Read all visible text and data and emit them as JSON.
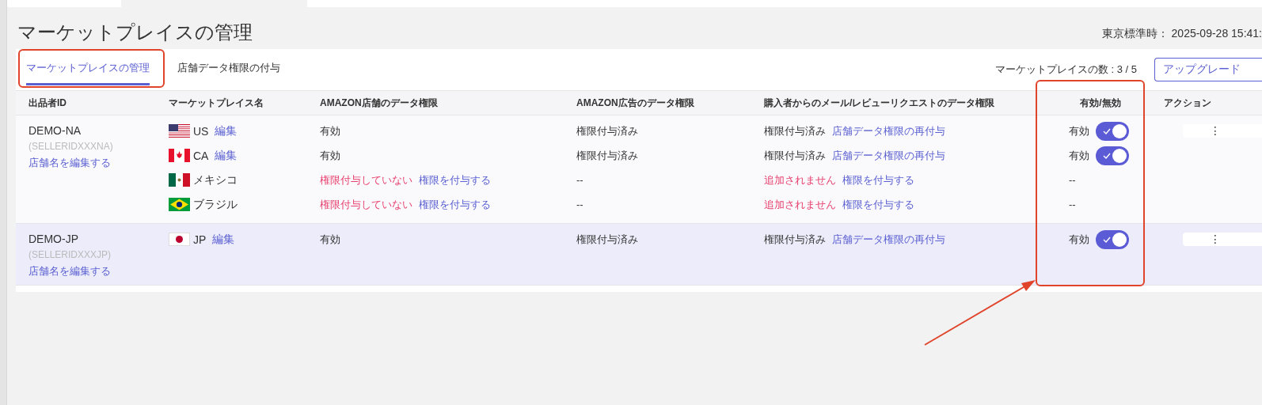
{
  "page_title": "マーケットプレイスの管理",
  "clock": "東京標準時： 2025-09-28 15:41:",
  "tabs": [
    {
      "label": "マーケットプレイスの管理",
      "selected": true
    },
    {
      "label": "店舗データ権限の付与",
      "selected": false
    }
  ],
  "marketplace_count": "マーケットプレイスの数 : 3 / 5",
  "upgrade_button": "アップグレード",
  "table": {
    "columns": [
      "出品者ID",
      "マーケットプレイス名",
      "AMAZON店舗のデータ権限",
      "AMAZON広告のデータ権限",
      "購入者からのメール/レビューリクエストのデータ権限",
      "有効/無効",
      "アクション"
    ],
    "groups": [
      {
        "seller": "DEMO-NA",
        "seller_code": "(SELLERIDXXXNA)",
        "edit_link": "店舗名を編集する",
        "selected": false,
        "rows": [
          {
            "kind": "us",
            "marketplace": "US",
            "edit": "編集",
            "store": {
              "text": "有効",
              "kind": "ok"
            },
            "ads": "権限付与済み",
            "buyer": {
              "text": "権限付与済み",
              "kind": "ok",
              "link": "店舗データ権限の再付与"
            },
            "toggle": {
              "label": "有効",
              "on": true
            },
            "menu": "⋮"
          },
          {
            "kind": "ca",
            "marketplace": "CA",
            "edit": "編集",
            "store": {
              "text": "有効",
              "kind": "ok"
            },
            "ads": "権限付与済み",
            "buyer": {
              "text": "権限付与済み",
              "kind": "ok",
              "link": "店舗データ権限の再付与"
            },
            "toggle": {
              "label": "有効",
              "on": true
            }
          },
          {
            "kind": "mx",
            "marketplace": "メキシコ",
            "store": {
              "text": "権限付与していない",
              "kind": "missing",
              "link": "権限を付与する"
            },
            "ads": "--",
            "buyer": {
              "text": "追加されません",
              "kind": "missing",
              "link": "権限を付与する"
            },
            "enabled_text": "--"
          },
          {
            "kind": "br",
            "marketplace": "ブラジル",
            "store": {
              "text": "権限付与していない",
              "kind": "missing",
              "link": "権限を付与する"
            },
            "ads": "--",
            "buyer": {
              "text": "追加されません",
              "kind": "missing",
              "link": "権限を付与する"
            },
            "enabled_text": "--"
          }
        ]
      },
      {
        "seller": "DEMO-JP",
        "seller_code": "(SELLERIDXXXJP)",
        "edit_link": "店舗名を編集する",
        "selected": true,
        "rows": [
          {
            "kind": "jp",
            "marketplace": "JP",
            "edit": "編集",
            "store": {
              "text": "有効",
              "kind": "ok"
            },
            "ads": "権限付与済み",
            "buyer": {
              "text": "権限付与済み",
              "kind": "ok",
              "link": "店舗データ権限の再付与"
            },
            "toggle": {
              "label": "有効",
              "on": true
            },
            "menu": "⋮"
          }
        ]
      }
    ]
  }
}
